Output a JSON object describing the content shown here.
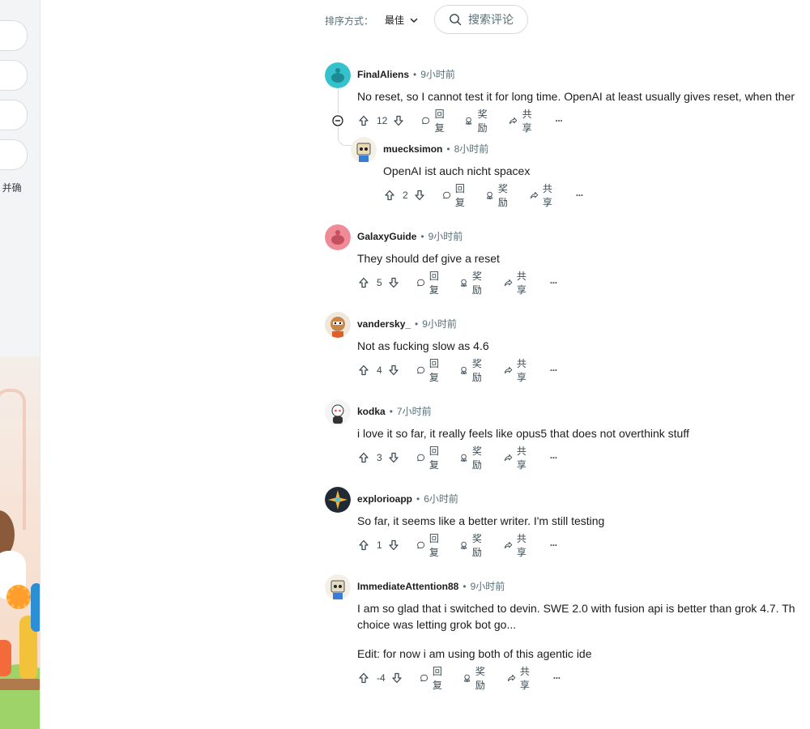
{
  "left_panel": {
    "partial_text": "\\ 并确"
  },
  "sort": {
    "label": "排序方式：",
    "value": "最佳"
  },
  "search": {
    "placeholder": "搜索评论"
  },
  "action_labels": {
    "reply": "回复",
    "award": "奖励",
    "share": "共享",
    "more": "···"
  },
  "comments": [
    {
      "author": "FinalAliens",
      "time": "9小时前",
      "text": "No reset, so I cannot test it for long time. OpenAI at least usually gives reset, when ther",
      "score": "12",
      "avatar_color": "#35c2cc"
    },
    {
      "author": "muecksimon",
      "time": "8小时前",
      "text": "OpenAI ist auch nicht spacex",
      "score": "2",
      "avatar_color": "#e9d9b5"
    },
    {
      "author": "GalaxyGuide",
      "time": "9小时前",
      "text": "They should def give a reset",
      "score": "5",
      "avatar_color": "#f08a97"
    },
    {
      "author": "vandersky_",
      "time": "9小时前",
      "text": "Not as fucking slow as 4.6",
      "score": "4",
      "avatar_color": "#c8864a"
    },
    {
      "author": "kodka",
      "time": "7小时前",
      "text": "i love it so far, it really feels like opus5 that does not overthink stuff",
      "score": "3",
      "avatar_color": "#f4f4f4"
    },
    {
      "author": "explorioapp",
      "time": "6小时前",
      "text": "So far, it seems like a better writer. I'm still testing",
      "score": "1",
      "avatar_color": "#1f2a36"
    },
    {
      "author": "ImmediateAttention88",
      "time": "9小时前",
      "text_line1": "I am so glad that i switched to devin. SWE 2.0 with fusion api is better than grok 4.7. Th",
      "text_line2": "choice was letting grok bot go...",
      "text_line3": "Edit: for now i am using both of this agentic ide",
      "score": "-4",
      "avatar_color": "#e6dcc4"
    }
  ]
}
